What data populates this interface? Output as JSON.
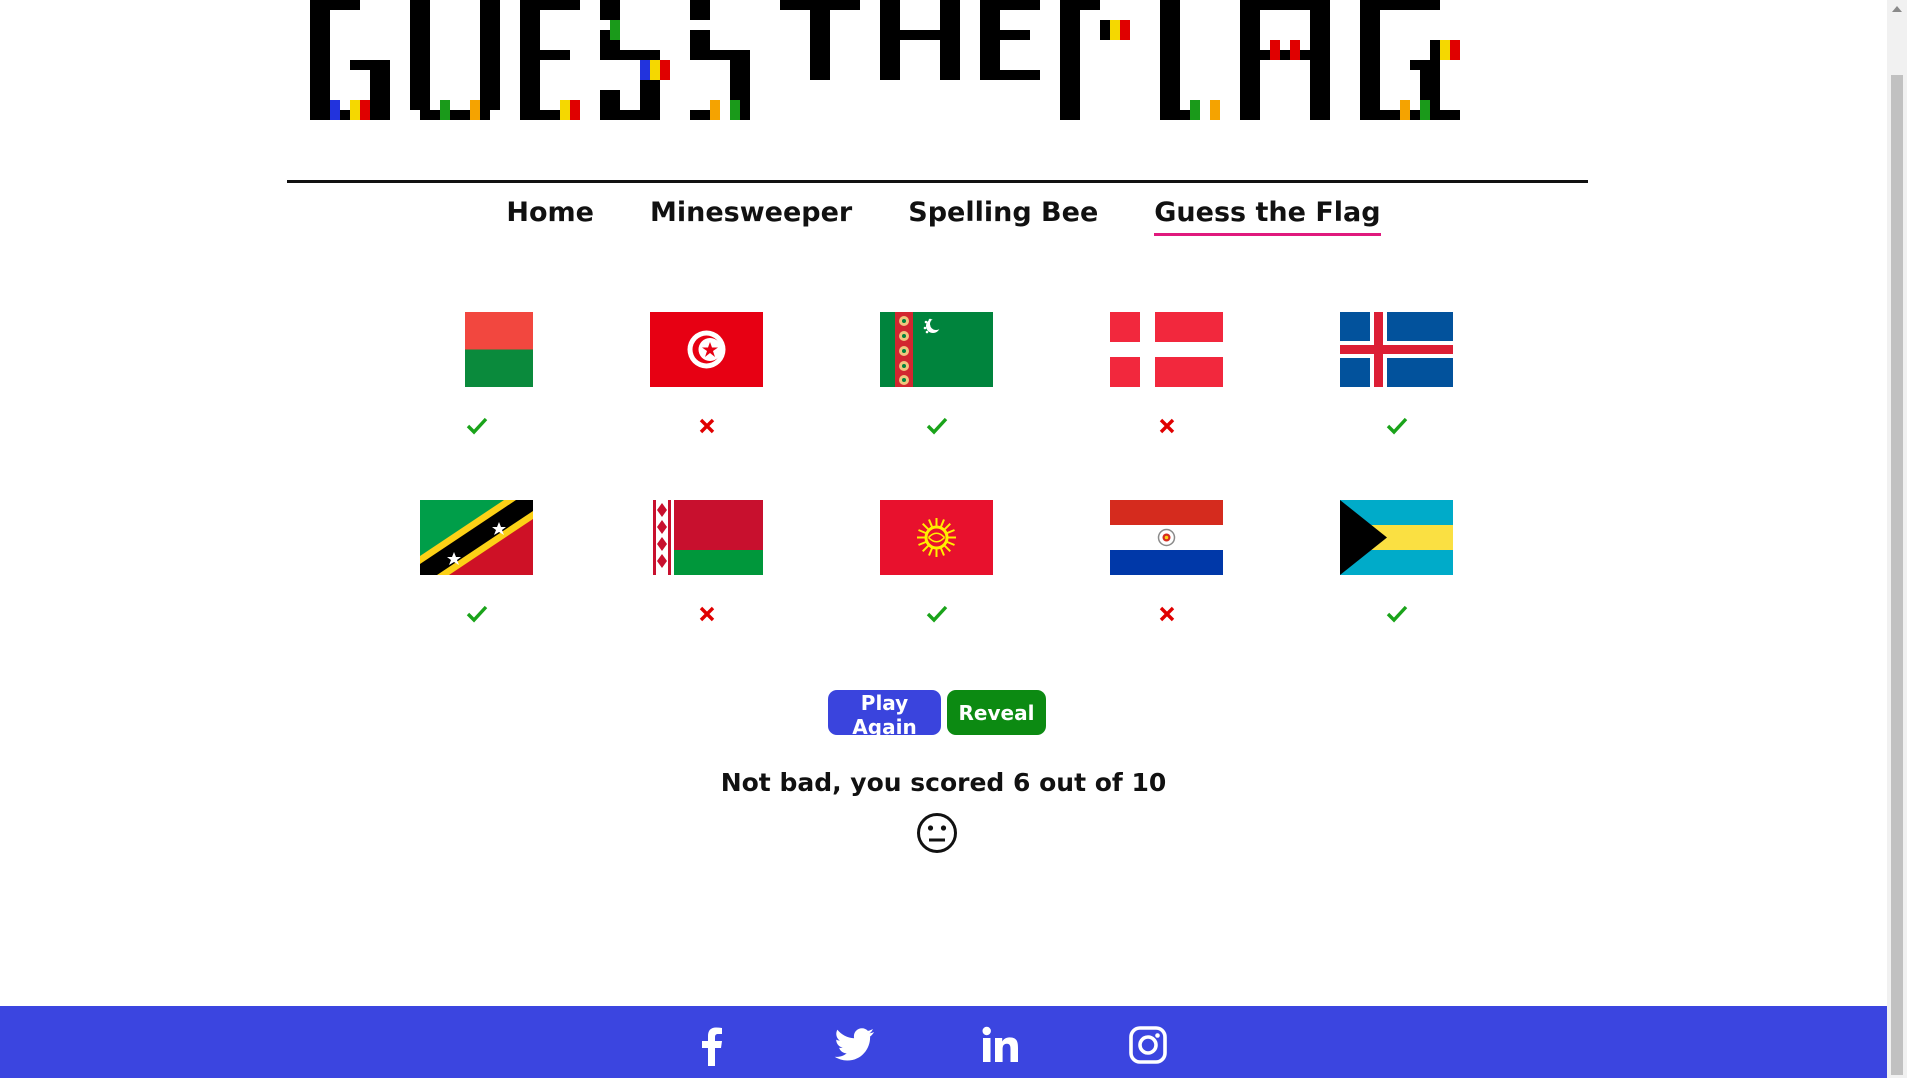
{
  "logo": {
    "alt_text": "GUESS THE FLAG"
  },
  "nav": {
    "items": [
      {
        "label": "Home",
        "active": false
      },
      {
        "label": "Minesweeper",
        "active": false
      },
      {
        "label": "Spelling Bee",
        "active": false
      },
      {
        "label": "Guess the Flag",
        "active": true
      }
    ],
    "active_underline_color": "#e0197d"
  },
  "flags": [
    {
      "country": "Madagascar",
      "result": "correct"
    },
    {
      "country": "Tunisia",
      "result": "incorrect"
    },
    {
      "country": "Turkmenistan",
      "result": "correct"
    },
    {
      "country": "Denmark",
      "result": "incorrect"
    },
    {
      "country": "Iceland",
      "result": "correct"
    },
    {
      "country": "Saint Kitts and Nevis",
      "result": "correct"
    },
    {
      "country": "Belarus",
      "result": "incorrect"
    },
    {
      "country": "Kyrgyzstan",
      "result": "correct"
    },
    {
      "country": "Paraguay",
      "result": "incorrect"
    },
    {
      "country": "Bahamas",
      "result": "correct"
    }
  ],
  "result_icons": {
    "correct": "checkmark-icon",
    "incorrect": "cross-icon"
  },
  "colors": {
    "correct": "#1aa31a",
    "incorrect": "#e00000",
    "play_again": "#3a44dd",
    "reveal": "#0c8a12",
    "footer": "#3b45e0"
  },
  "buttons": {
    "play_again": "Play Again",
    "reveal": "Reveal"
  },
  "score": {
    "message": "Not bad, you scored 6 out of 10",
    "icon": "neutral-face-icon"
  },
  "footer": {
    "socials": [
      "facebook-icon",
      "twitter-icon",
      "linkedin-icon",
      "instagram-icon"
    ]
  }
}
